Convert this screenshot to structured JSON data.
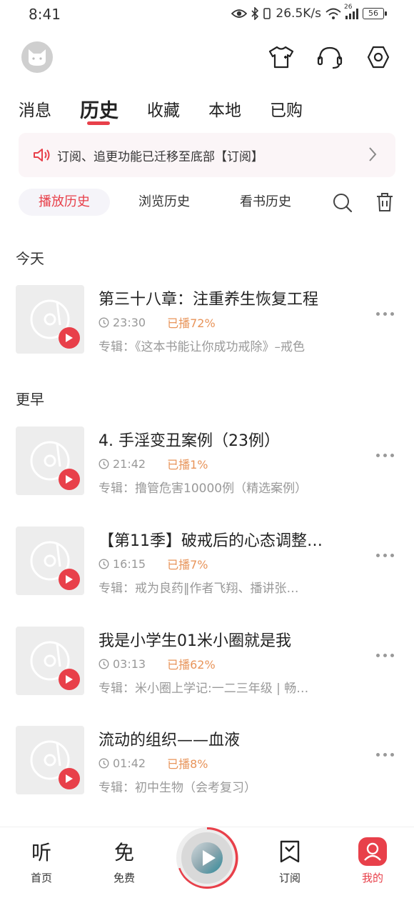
{
  "status_bar": {
    "time": "8:41",
    "speed": "26.5K/s",
    "signal_label": "26",
    "battery": "56"
  },
  "tabs": [
    "消息",
    "历史",
    "收藏",
    "本地",
    "已购"
  ],
  "active_tab": "历史",
  "notice": {
    "text": "订阅、追更功能已迁移至底部【订阅】"
  },
  "sub_tabs": [
    "播放历史",
    "浏览历史",
    "看书历史"
  ],
  "sections": {
    "today": "今天",
    "earlier": "更早"
  },
  "items": [
    {
      "title": "第三十八章：注重养生恢复工程",
      "duration": "23:30",
      "played": "已播72%",
      "album": "专辑：《这本书能让你成功戒除》–戒色"
    },
    {
      "title": "4. 手淫变丑案例（23例）",
      "duration": "21:42",
      "played": "已播1%",
      "album": "专辑：撸管危害10000例（精选案例）"
    },
    {
      "title": "【第11季】破戒后的心态调整…",
      "duration": "16:15",
      "played": "已播7%",
      "album": "专辑：戒为良药‖作者飞翔、播讲张…"
    },
    {
      "title": "我是小学生01米小圈就是我",
      "duration": "03:13",
      "played": "已播62%",
      "album": "专辑：米小圈上学记:一二三年级 | 畅…"
    },
    {
      "title": "流动的组织——血液",
      "duration": "01:42",
      "played": "已播8%",
      "album": "专辑：初中生物（会考复习）"
    }
  ],
  "bottom_nav": [
    {
      "label": "首页",
      "icon": "听"
    },
    {
      "label": "免费",
      "icon": "免"
    },
    {
      "label": "订阅"
    },
    {
      "label": "我的"
    }
  ],
  "colors": {
    "accent": "#e8404a",
    "played": "#e8945a",
    "muted": "#999999"
  }
}
